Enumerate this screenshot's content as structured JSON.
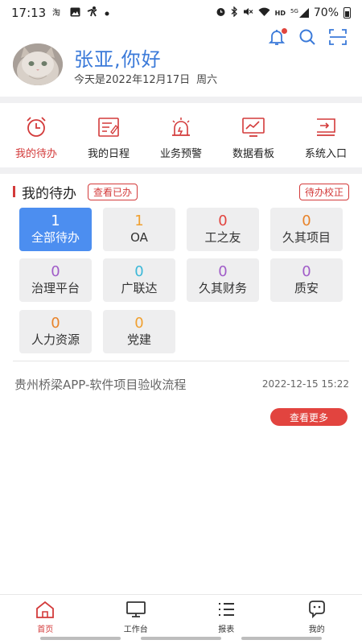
{
  "status_bar": {
    "time": "17:13",
    "left_icons": [
      "taobao-icon",
      "image-icon",
      "activity-icon",
      "dot-icon"
    ],
    "right_icons": [
      "alarm-icon",
      "bluetooth-icon",
      "mute-icon",
      "wifi-icon",
      "hd-icon",
      "signal-5g-icon"
    ],
    "hd_text": "HD",
    "net_text": "5G",
    "battery": "70%"
  },
  "header": {
    "greeting": "张亚,你好",
    "date_text": "今天是2022年12月17日",
    "weekday": "周六",
    "icons": [
      "bell-icon",
      "search-icon",
      "scan-icon"
    ]
  },
  "quick_nav": [
    {
      "label": "我的待办",
      "icon": "alarm-clock-icon",
      "active": true
    },
    {
      "label": "我的日程",
      "icon": "schedule-icon",
      "active": false
    },
    {
      "label": "业务预警",
      "icon": "siren-icon",
      "active": false
    },
    {
      "label": "数据看板",
      "icon": "dashboard-icon",
      "active": false
    },
    {
      "label": "系统入口",
      "icon": "system-entry-icon",
      "active": false
    }
  ],
  "todo": {
    "title": "我的待办",
    "view_done": "查看已办",
    "correct": "待办校正",
    "tiles": [
      {
        "count": "1",
        "label": "全部待办",
        "color": "#ffffff",
        "active": true
      },
      {
        "count": "1",
        "label": "OA",
        "color": "#f0a030"
      },
      {
        "count": "0",
        "label": "工之友",
        "color": "#e2443f"
      },
      {
        "count": "0",
        "label": "久其项目",
        "color": "#e8832a"
      },
      {
        "count": "0",
        "label": "治理平台",
        "color": "#a05cc8"
      },
      {
        "count": "0",
        "label": "广联达",
        "color": "#3cb8d8"
      },
      {
        "count": "0",
        "label": "久其财务",
        "color": "#a05cc8"
      },
      {
        "count": "0",
        "label": "质安",
        "color": "#a05cc8"
      },
      {
        "count": "0",
        "label": "人力资源",
        "color": "#e8832a"
      },
      {
        "count": "0",
        "label": "党建",
        "color": "#f0a030"
      }
    ],
    "items": [
      {
        "title": "贵州桥梁APP-软件项目验收流程",
        "time": "2022-12-15 15:22"
      }
    ],
    "more": "查看更多"
  },
  "tabbar": [
    {
      "label": "首页",
      "icon": "home-icon",
      "active": true
    },
    {
      "label": "工作台",
      "icon": "monitor-icon",
      "active": false
    },
    {
      "label": "报表",
      "icon": "list-icon",
      "active": false
    },
    {
      "label": "我的",
      "icon": "robot-face-icon",
      "active": false
    }
  ],
  "colors": {
    "accent_red": "#d33a3a",
    "accent_blue": "#4c8ef0",
    "greeting_blue": "#3b7ad9"
  }
}
